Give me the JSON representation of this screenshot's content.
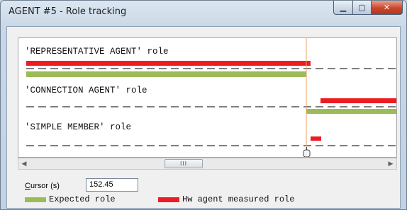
{
  "window": {
    "title": "AGENT #5 - Role tracking",
    "controls": [
      "minimize-icon",
      "maximize-icon",
      "close-icon"
    ]
  },
  "colors": {
    "expected": "#9bbb59",
    "measured": "#ed1c24",
    "cursor_line": "#f0a060"
  },
  "tracks": [
    {
      "label": "'REPRESENTATIVE AGENT' role"
    },
    {
      "label": "'CONNECTION AGENT' role"
    },
    {
      "label": "'SIMPLE MEMBER' role"
    }
  ],
  "scrollbar": {
    "left_arrow": "◀",
    "right_arrow": "▶",
    "thumb_grip": "III"
  },
  "cursor": {
    "label_prefix": "C",
    "label_rest": "ursor (s)",
    "value": "152.45"
  },
  "legend": {
    "expected_label": "Expected role",
    "measured_label": "Hw agent measured role"
  }
}
